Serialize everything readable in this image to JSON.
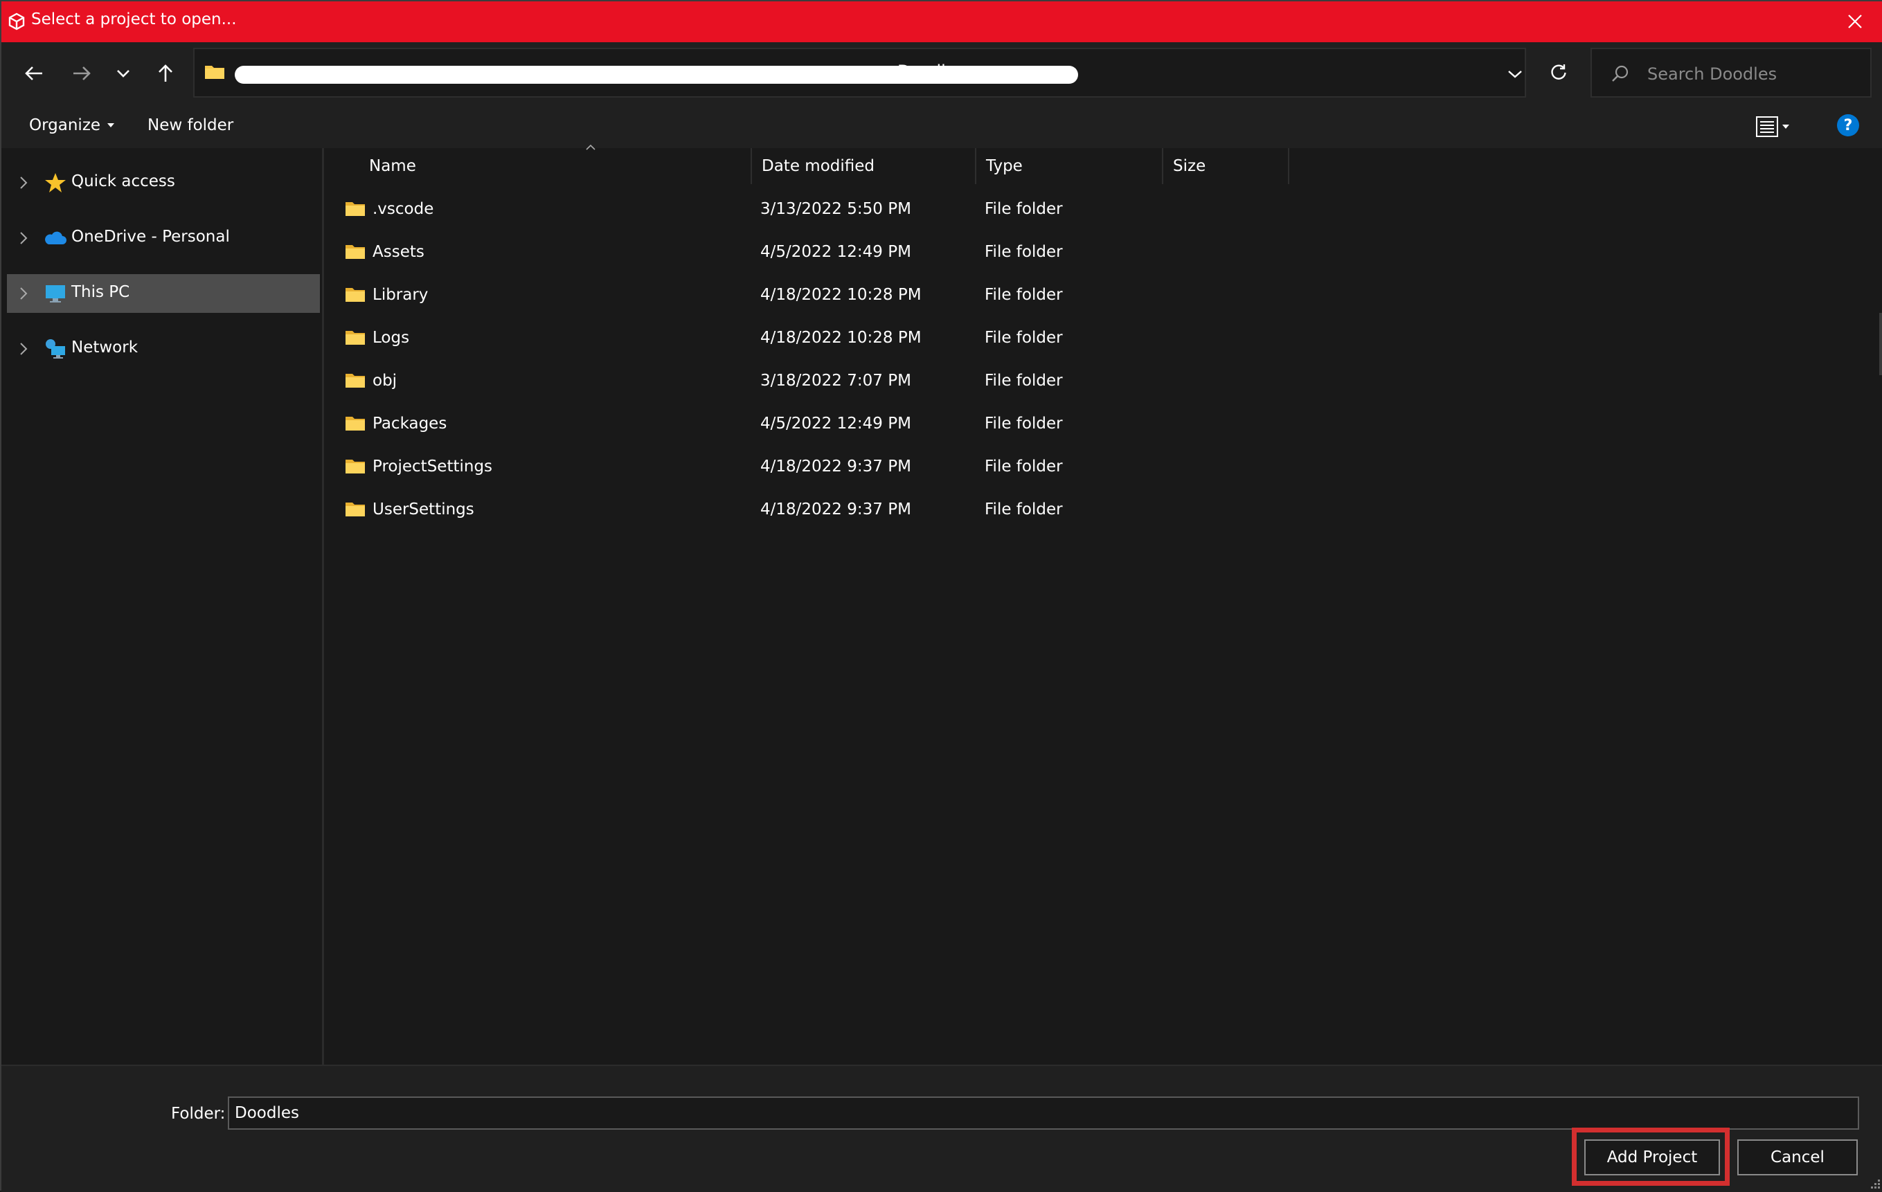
{
  "window": {
    "title": "Select a project to open...",
    "accent_color": "#e81123",
    "app_icon": "unity-logo-icon",
    "close_icon": "close-icon"
  },
  "nav": {
    "back_icon": "arrow-left-icon",
    "forward_icon": "arrow-right-icon",
    "recent_icon": "chevron-down-icon",
    "up_icon": "arrow-up-icon",
    "address_folder_icon": "folder-icon",
    "address_current": "Doodles",
    "address_dropdown_icon": "chevron-down-icon",
    "refresh_icon": "refresh-icon",
    "search_placeholder": "Search Doodles",
    "search_icon": "search-icon"
  },
  "commands": {
    "organize": "Organize",
    "new_folder": "New folder",
    "view_icon": "details-view-icon",
    "help": "?"
  },
  "sidebar": {
    "items": [
      {
        "label": "Quick access",
        "icon": "star-icon",
        "selected": false
      },
      {
        "label": "OneDrive - Personal",
        "icon": "cloud-icon",
        "selected": false
      },
      {
        "label": "This PC",
        "icon": "monitor-icon",
        "selected": true
      },
      {
        "label": "Network",
        "icon": "network-icon",
        "selected": false
      }
    ]
  },
  "files": {
    "columns": [
      "Name",
      "Date modified",
      "Type",
      "Size"
    ],
    "rows": [
      {
        "name": ".vscode",
        "date": "3/13/2022 5:50 PM",
        "type": "File folder"
      },
      {
        "name": "Assets",
        "date": "4/5/2022 12:49 PM",
        "type": "File folder"
      },
      {
        "name": "Library",
        "date": "4/18/2022 10:28 PM",
        "type": "File folder"
      },
      {
        "name": "Logs",
        "date": "4/18/2022 10:28 PM",
        "type": "File folder"
      },
      {
        "name": "obj",
        "date": "3/18/2022 7:07 PM",
        "type": "File folder"
      },
      {
        "name": "Packages",
        "date": "4/5/2022 12:49 PM",
        "type": "File folder"
      },
      {
        "name": "ProjectSettings",
        "date": "4/18/2022 9:37 PM",
        "type": "File folder"
      },
      {
        "name": "UserSettings",
        "date": "4/18/2022 9:37 PM",
        "type": "File folder"
      }
    ]
  },
  "footer": {
    "folder_label": "Folder:",
    "folder_value": "Doodles",
    "add_project": "Add Project",
    "cancel": "Cancel",
    "highlight_color": "#d32f2f"
  }
}
